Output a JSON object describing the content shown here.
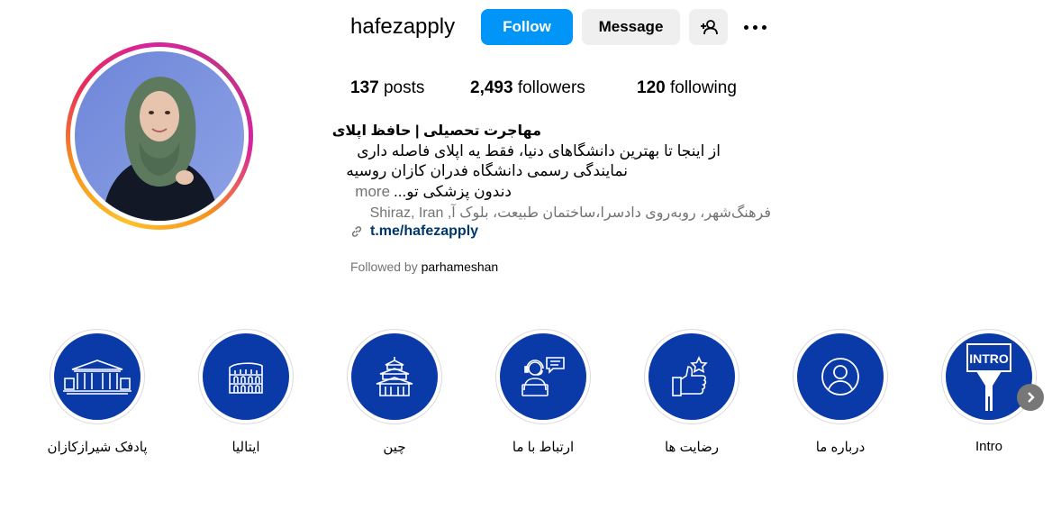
{
  "profile": {
    "username": "hafezapply",
    "follow_label": "Follow",
    "message_label": "Message",
    "stats": {
      "posts_count": "137",
      "posts_label": "posts",
      "followers_count": "2,493",
      "followers_label": "followers",
      "following_count": "120",
      "following_label": "following"
    },
    "bio": {
      "name": "مهاجرت تحصیلی | حافظ اپلای",
      "line1": "از اینجا تا بهترین دانشگاهای دنیا، فقط یه اپلای فاصله داری",
      "line2": "نمایندگی رسمی دانشگاه فدران کازان روسیه",
      "line3": "دندون پزشکی تو...",
      "more_label": "more",
      "location": "فرهنگ‌شهر، روبه‌روی دادسرا،ساختمان طبیعت، بلوک آ, Shiraz, Iran",
      "link": "t.me/hafezapply"
    },
    "followed_by_label": "Followed by",
    "followed_by_user": "parhameshan"
  },
  "highlights": [
    {
      "label": "پادفک شیرازکازان",
      "icon": "building-icon"
    },
    {
      "label": "ایتالیا",
      "icon": "colosseum-icon"
    },
    {
      "label": "چین",
      "icon": "pagoda-icon"
    },
    {
      "label": "ارتباط با ما",
      "icon": "support-agent-icon"
    },
    {
      "label": "رضایت ها",
      "icon": "thumbs-up-star-icon"
    },
    {
      "label": "درباره ما",
      "icon": "user-circle-icon"
    },
    {
      "label": "Intro",
      "icon": "intro-sign-icon"
    }
  ],
  "colors": {
    "follow_button": "#0095f6",
    "secondary_button": "#efefef",
    "highlight_fill": "#0a3aa7",
    "link": "#00376b",
    "muted_text": "#737373"
  }
}
